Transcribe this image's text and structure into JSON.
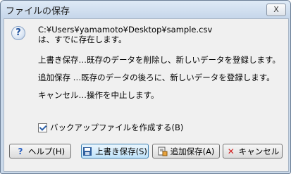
{
  "window": {
    "title": "ファイルの保存",
    "close_symbol": "X"
  },
  "dialog": {
    "path": "C:¥Users¥yamamoto¥Desktop¥sample.csv",
    "exists_msg": "は、すでに存在します。",
    "overwrite_desc": "上書き保存…既存のデータを削除し、新しいデータを登録します。",
    "append_desc": "追加保存 …既存のデータの後ろに、新しいデータを登録します。",
    "cancel_desc": "キャンセル…操作を中止します。",
    "backup_label": "バックアップファイルを作成する(B)",
    "backup_checked": true
  },
  "buttons": {
    "help": "ヘルプ(H)",
    "overwrite": "上書き保存(S)",
    "append": "追加保存(A)",
    "cancel": "キャンセル"
  },
  "icons": {
    "question": "question-icon",
    "help": "help-icon",
    "save": "floppy-icon",
    "append": "append-icon",
    "cancel": "cancel-x-icon"
  }
}
